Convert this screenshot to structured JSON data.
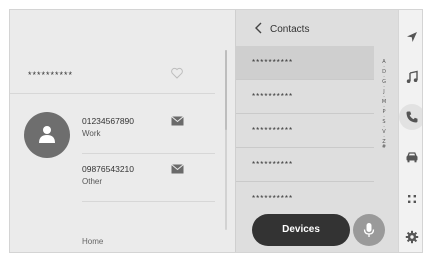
{
  "detail": {
    "contact_name": "**********",
    "phones": [
      {
        "number": "01234567890",
        "type": "Work"
      },
      {
        "number": "09876543210",
        "type": "Other"
      }
    ],
    "home_label": "Home"
  },
  "contacts": {
    "title": "Contacts",
    "items": [
      "**********",
      "**********",
      "**********",
      "**********",
      "**********"
    ],
    "alphabet": [
      "A",
      "·",
      "D",
      "·",
      "G",
      "·",
      "J",
      "·",
      "M",
      "·",
      "P",
      "·",
      "S",
      "·",
      "V",
      "·",
      "Z",
      "#"
    ],
    "devices_label": "Devices"
  },
  "rail": {
    "items": [
      "navigation-icon",
      "music-icon",
      "phone-icon",
      "car-icon",
      "apps-icon",
      "settings-icon"
    ],
    "active": "phone-icon"
  },
  "colors": {
    "dark_button": "#333333",
    "mic_button": "#9a9a9a"
  }
}
